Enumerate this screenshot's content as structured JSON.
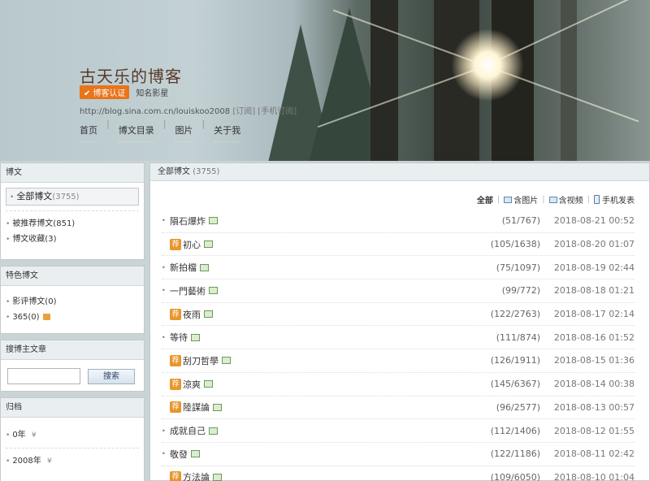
{
  "header": {
    "blog_title": "古天乐的博客",
    "badge_label": "博客认证",
    "badge_sub": "知名影星",
    "url": "http://blog.sina.com.cn/louiskoo2008",
    "url_extra": "[订阅] [手机订阅]",
    "nav": [
      "首页",
      "博文目录",
      "图片",
      "关于我"
    ]
  },
  "sidebar": {
    "blog_panel": {
      "title": "博文",
      "active_label": "全部博文",
      "active_count": "(3755)",
      "items": [
        "被推荐博文(851)",
        "博文收藏(3)"
      ]
    },
    "special_panel": {
      "title": "特色博文",
      "items": [
        "影评博文(0)",
        "365(0)"
      ]
    },
    "search_panel": {
      "title": "搜博主文章",
      "button": "搜索",
      "placeholder": ""
    },
    "archive_panel": {
      "title": "归档",
      "items": [
        "0年",
        "2008年"
      ]
    }
  },
  "main": {
    "header_title": "全部博文",
    "header_count": "(3755)",
    "filters": {
      "all": "全部",
      "with_pic": "含图片",
      "with_video": "含视频",
      "mobile": "手机发表"
    },
    "posts": [
      {
        "title": "隕石爆炸",
        "rec": false,
        "stats": "(51/767)",
        "date": "2018-08-21 00:52"
      },
      {
        "title": "初心",
        "rec": true,
        "stats": "(105/1638)",
        "date": "2018-08-20 01:07"
      },
      {
        "title": "新拍檔",
        "rec": false,
        "stats": "(75/1097)",
        "date": "2018-08-19 02:44"
      },
      {
        "title": "一門藝術",
        "rec": false,
        "stats": "(99/772)",
        "date": "2018-08-18 01:21"
      },
      {
        "title": "夜雨",
        "rec": true,
        "stats": "(122/2763)",
        "date": "2018-08-17 02:14"
      },
      {
        "title": "等待",
        "rec": false,
        "stats": "(111/874)",
        "date": "2018-08-16 01:52"
      },
      {
        "title": "刮刀哲學",
        "rec": true,
        "stats": "(126/1911)",
        "date": "2018-08-15 01:36"
      },
      {
        "title": "涼爽",
        "rec": true,
        "stats": "(145/6367)",
        "date": "2018-08-14 00:38"
      },
      {
        "title": "陸謀論",
        "rec": true,
        "stats": "(96/2577)",
        "date": "2018-08-13 00:57"
      },
      {
        "title": "成就自己",
        "rec": false,
        "stats": "(112/1406)",
        "date": "2018-08-12 01:55"
      },
      {
        "title": "敬發",
        "rec": false,
        "stats": "(122/1186)",
        "date": "2018-08-11 02:42"
      },
      {
        "title": "方法論",
        "rec": true,
        "stats": "(109/6050)",
        "date": "2018-08-10 01:04"
      }
    ],
    "rec_badge": "荐"
  }
}
